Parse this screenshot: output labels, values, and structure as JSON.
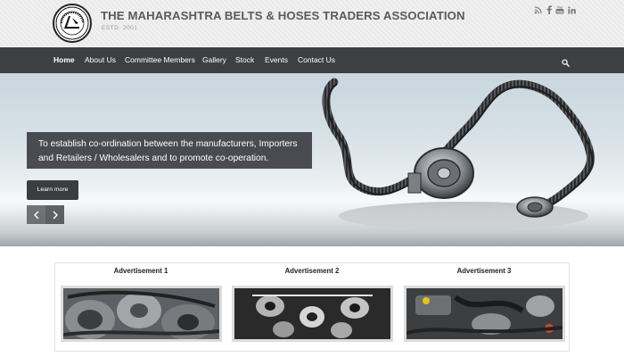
{
  "header": {
    "title": "THE MAHARASHTRA BELTS & HOSES TRADERS ASSOCIATION",
    "subtitle": "ESTD. 2001",
    "logo_text": "THE M.B.H.T.A. ESTD. 2001",
    "social": [
      {
        "name": "rss-icon"
      },
      {
        "name": "facebook-icon",
        "glyph": "f"
      },
      {
        "name": "youtube-icon",
        "glyph": "You"
      },
      {
        "name": "linkedin-icon",
        "glyph": "in"
      }
    ]
  },
  "nav": {
    "items": [
      {
        "label": "Home"
      },
      {
        "label": "About Us"
      },
      {
        "label": "Committee Members"
      },
      {
        "label": "Gallery"
      },
      {
        "label": "Stock"
      },
      {
        "label": "Events"
      },
      {
        "label": "Contact Us"
      }
    ]
  },
  "hero": {
    "caption": "To establish co-ordination between the manufacturers, Importers and Retailers / Wholesalers and to promote co-operation.",
    "button_label": "Learn more"
  },
  "ads": [
    {
      "title": "Advertisement 1"
    },
    {
      "title": "Advertisement 2"
    },
    {
      "title": "Advertisement 3"
    }
  ],
  "colors": {
    "nav_bg": "#3d3f43",
    "title_gray": "#5a5a5a",
    "caption_bg": "#34363a"
  }
}
